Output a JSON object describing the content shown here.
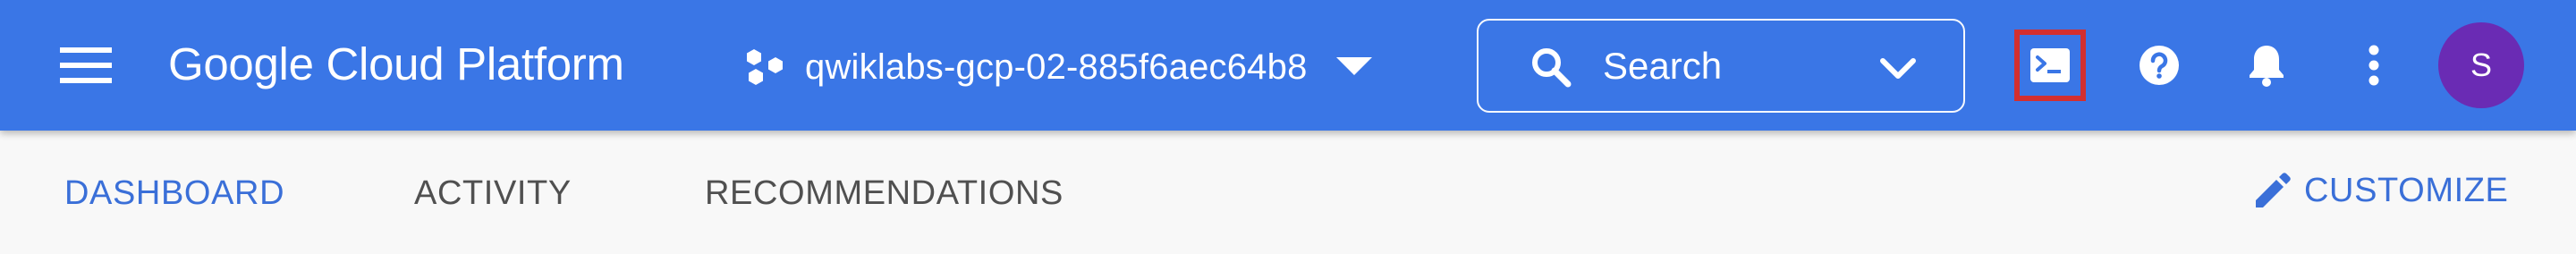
{
  "app": {
    "product_name": "Google Cloud Platform"
  },
  "project": {
    "name": "qwiklabs-gcp-02-885f6aec64b8"
  },
  "search": {
    "label": "Search"
  },
  "user": {
    "avatar_initial": "S",
    "avatar_color": "#6a2bb4"
  },
  "icons": {
    "menu": "hamburger-menu-icon",
    "project": "project-hexagons-icon",
    "project_caret": "caret-down-icon",
    "search": "search-icon",
    "search_expand": "chevron-down-icon",
    "cloud_shell": "terminal-icon",
    "help": "help-circle-icon",
    "notifications": "bell-icon",
    "more": "more-vert-icon",
    "customize": "pencil-icon"
  },
  "colors": {
    "topbar": "#3a76e6",
    "active_tab": "#3a6fd8",
    "inactive_tab": "#505050",
    "highlight_border": "#d32f2f"
  },
  "tabs": [
    {
      "label": "DASHBOARD",
      "active": true
    },
    {
      "label": "ACTIVITY",
      "active": false
    },
    {
      "label": "RECOMMENDATIONS",
      "active": false
    }
  ],
  "actions": {
    "customize_label": "CUSTOMIZE"
  }
}
